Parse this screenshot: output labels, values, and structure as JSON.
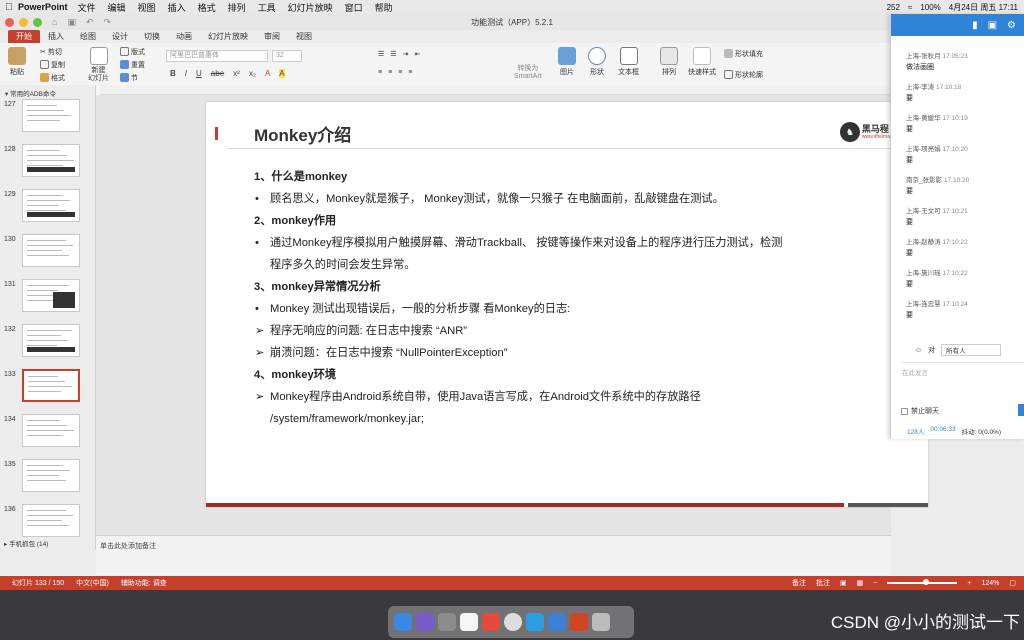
{
  "menubar": {
    "app": "PowerPoint",
    "items": [
      "文件",
      "编辑",
      "视图",
      "插入",
      "格式",
      "排列",
      "工具",
      "幻灯片放映",
      "窗口",
      "帮助"
    ],
    "status": [
      "252",
      "100%",
      "4月24日 周五 17:11"
    ]
  },
  "window": {
    "title": "功能测试（APP）5.2.1",
    "tabs": [
      "开始",
      "插入",
      "绘图",
      "设计",
      "切换",
      "动画",
      "幻灯片放映",
      "审阅",
      "视图"
    ]
  },
  "ribbon": {
    "paste": "粘贴",
    "cut": "剪切",
    "copy": "复制",
    "format": "格式",
    "new_slide": "新建\n幻灯片",
    "layout": "版式",
    "reset": "重置",
    "section": "节",
    "font_name": "阿里巴巴普惠体",
    "font_size": "32",
    "format_row": [
      "B",
      "I",
      "U",
      "abe",
      "x²",
      "x₂",
      "A",
      "A"
    ],
    "convert_smartart": "转换为\nSmartArt",
    "picture": "图片",
    "shape": "形状",
    "textbox": "文本框",
    "arrange": "排列",
    "quick_styles": "快速样式",
    "shape_fill": "形状填充",
    "shape_outline": "形状轮廓"
  },
  "thumbnails": {
    "section_head": "常用的ADB命令",
    "section_foot": "手机抓包 (14)",
    "items": [
      {
        "num": "127",
        "selected": false
      },
      {
        "num": "128",
        "selected": false
      },
      {
        "num": "129",
        "selected": false
      },
      {
        "num": "130",
        "selected": false
      },
      {
        "num": "131",
        "selected": false
      },
      {
        "num": "132",
        "selected": false
      },
      {
        "num": "133",
        "selected": true
      },
      {
        "num": "134",
        "selected": false
      },
      {
        "num": "135",
        "selected": false
      },
      {
        "num": "136",
        "selected": false
      }
    ]
  },
  "slide": {
    "title": "Monkey介绍",
    "logo": "黑马程",
    "logo_sub": "www.itheima",
    "h1": "1、什么是monkey",
    "p1": "顾名思义，Monkey就是猴子， Monkey测试，就像一只猴子 在电脑面前，乱敲键盘在测试。",
    "h2": "2、monkey作用",
    "p2a": "通过Monkey程序模拟用户触摸屏幕、滑动Trackball、 按键等操作来对设备上的程序进行压力测试，检测",
    "p2b": "程序多久的时间会发生异常。",
    "h3": "3、monkey异常情况分析",
    "p3": "Monkey 测试出现错误后，一般的分析步骤 看Monkey的日志:",
    "p4": "程序无响应的问题: 在日志中搜索 “ANR”",
    "p5": "崩溃问题：在日志中搜索 “NullPointerException”",
    "h4": "4、monkey环境",
    "p6a": "Monkey程序由Android系统自带，使用Java语言写成，在Android文件系统中的存放路径",
    "p6b": "/system/framework/monkey.jar;",
    "bullet": "•",
    "arrow": "➢"
  },
  "notes": "单击此处添加备注",
  "status": {
    "slide": "幻灯片 133 / 150",
    "lang": "中文(中国)",
    "access": "辅助功能: 调查",
    "notes_btn": "备注",
    "comments_btn": "批注",
    "zoom": "124%",
    "zoom_level": 0.55
  },
  "chat": {
    "messages": [
      {
        "who": "上海-张秋月",
        "time": "17:05:23",
        "text": "做法画圈"
      },
      {
        "who": "上海-李涛",
        "time": "17:10:18",
        "text": "要"
      },
      {
        "who": "上海-黄媛华",
        "time": "17:10:19",
        "text": "要"
      },
      {
        "who": "上海-项亮娟",
        "time": "17:10:20",
        "text": "要"
      },
      {
        "who": "南京_张影影",
        "time": "17:10:20",
        "text": "要"
      },
      {
        "who": "上海-王文可",
        "time": "17:10:21",
        "text": "要"
      },
      {
        "who": "上海-赵静涛",
        "time": "17:10:22",
        "text": "要"
      },
      {
        "who": "上海-施川瑶",
        "time": "17:10:22",
        "text": "要"
      },
      {
        "who": "上海-连忠慧",
        "time": "17:10:24",
        "text": "要"
      }
    ],
    "to_label": "对",
    "to_value": "所有人",
    "input_placeholder": "在此发言",
    "ban_label": "禁止聊天",
    "people": "128人",
    "duration": "00:06:33",
    "latency": "抖动: 0(0.0%)"
  },
  "watermark": "CSDN @小小的测试一下",
  "colors": {
    "accent": "#c5402c",
    "chat_blue": "#2f84d8"
  }
}
